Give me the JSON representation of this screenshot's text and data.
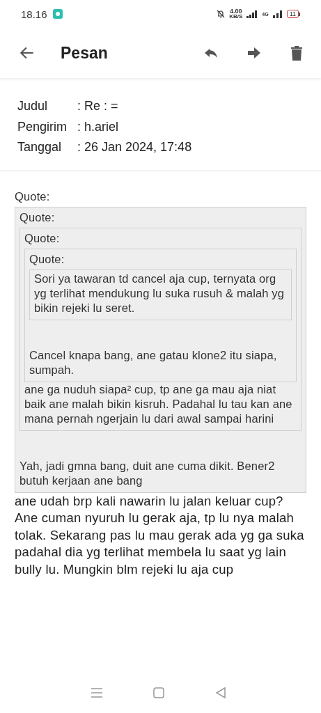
{
  "status_bar": {
    "time": "18.16",
    "speed": "4.00",
    "speed_unit": "KB/S",
    "network": "4G",
    "battery": "11"
  },
  "header": {
    "title": "Pesan"
  },
  "meta": [
    {
      "label": "Judul",
      "value": ": Re : ="
    },
    {
      "label": "Pengirim",
      "value": ": h.ariel"
    },
    {
      "label": "Tanggal",
      "value": ": 26 Jan 2024, 17:48"
    }
  ],
  "message": {
    "quote": {
      "label": "Quote:",
      "quote": {
        "label": "Quote:",
        "quote": {
          "label": "Quote:",
          "quote": {
            "label": "Quote:",
            "text": "Sori ya tawaran td cancel aja cup, ternyata org yg terlihat mendukung lu suka rusuh & malah yg bikin rejeki lu seret."
          },
          "text": "Cancel knapa bang, ane gatau klone2 itu siapa, sumpah."
        },
        "text": "ane ga nuduh siapa² cup, tp ane ga mau aja niat baik ane malah bikin kisruh. Padahal lu tau kan ane mana pernah ngerjain lu dari awal sampai harini"
      },
      "text": "Yah, jadi gmna bang, duit ane cuma dikit. Bener2 butuh kerjaan ane bang"
    },
    "text": "ane udah brp kali nawarin lu jalan keluar cup? Ane cuman nyuruh lu gerak aja, tp lu nya malah tolak. Sekarang pas lu mau gerak ada yg ga suka padahal dia yg terlihat membela lu saat yg lain bully lu. Mungkin blm rejeki lu aja cup"
  }
}
